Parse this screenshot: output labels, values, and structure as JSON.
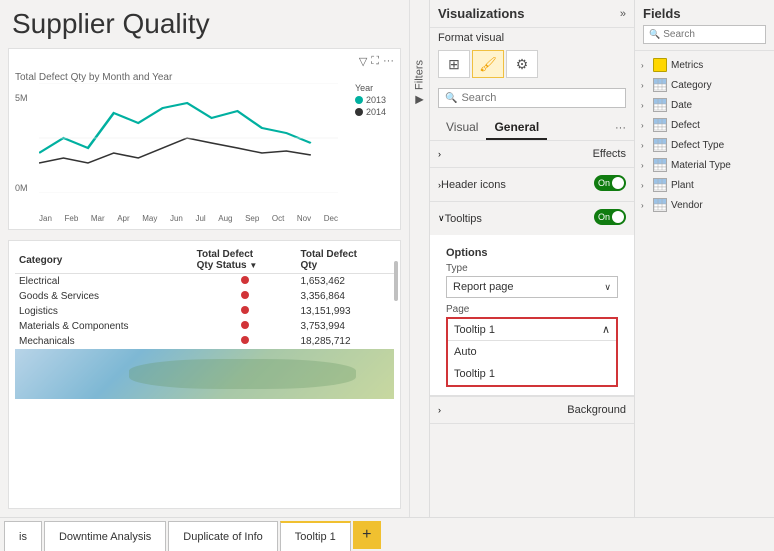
{
  "report": {
    "title": "Supplier Quality",
    "chart": {
      "title": "Total Defect Qty by Month and Year",
      "y_labels": [
        "5M",
        "0M"
      ],
      "x_labels": [
        "Jan",
        "Feb",
        "Mar",
        "Apr",
        "May",
        "Jun",
        "Jul",
        "Aug",
        "Sep",
        "Oct",
        "Nov",
        "Dec"
      ],
      "legend": {
        "year1": "2013",
        "year2": "2014",
        "color1": "#00b0a0",
        "color2": "#333333"
      }
    },
    "table": {
      "columns": [
        "Category",
        "Total Defect Qty Status",
        "Total Defect Qty"
      ],
      "rows": [
        {
          "category": "Electrical",
          "value": "1,653,462"
        },
        {
          "category": "Goods & Services",
          "value": "3,356,864"
        },
        {
          "category": "Logistics",
          "value": "13,151,993"
        },
        {
          "category": "Materials & Components",
          "value": "3,753,994"
        },
        {
          "category": "Mechanicals",
          "value": "18,285,712"
        }
      ]
    }
  },
  "filters": {
    "label": "Filters"
  },
  "visualizations": {
    "title": "Visualizations",
    "expand_icon": "»",
    "format_visual_label": "Format visual",
    "icons": [
      {
        "name": "grid-icon",
        "symbol": "⊞",
        "active": false
      },
      {
        "name": "paint-icon",
        "symbol": "🖌",
        "active": true
      },
      {
        "name": "analytics-icon",
        "symbol": "⚙",
        "active": false
      }
    ],
    "search_placeholder": "Search",
    "tabs": [
      "Visual",
      "General"
    ],
    "active_tab": "General",
    "more_label": "...",
    "sections": {
      "effects": {
        "label": "Effects",
        "expanded": false
      },
      "header_icons": {
        "label": "Header icons",
        "toggle": "On",
        "expanded": false
      },
      "tooltips": {
        "label": "Tooltips",
        "toggle": "On",
        "expanded": true
      },
      "options": {
        "label": "Options",
        "type_label": "Type",
        "type_value": "Report page",
        "page_label": "Page",
        "page_value": "Tooltip 1",
        "page_options": [
          "Auto",
          "Tooltip 1"
        ]
      },
      "background": {
        "label": "Background",
        "expanded": false
      }
    }
  },
  "fields": {
    "title": "Fields",
    "search_placeholder": "Search",
    "items": [
      {
        "name": "Metrics",
        "icon": "yellow",
        "expanded": false
      },
      {
        "name": "Category",
        "icon": "table",
        "expanded": false
      },
      {
        "name": "Date",
        "icon": "table",
        "expanded": false
      },
      {
        "name": "Defect",
        "icon": "table",
        "expanded": false
      },
      {
        "name": "Defect Type",
        "icon": "table",
        "expanded": false
      },
      {
        "name": "Material Type",
        "icon": "table",
        "expanded": false
      },
      {
        "name": "Plant",
        "icon": "table",
        "expanded": false
      },
      {
        "name": "Vendor",
        "icon": "table",
        "expanded": false
      }
    ]
  },
  "tabs": {
    "items": [
      "is",
      "Downtime Analysis",
      "Duplicate of Info",
      "Tooltip 1"
    ],
    "active": "Tooltip 1",
    "add_label": "+"
  }
}
